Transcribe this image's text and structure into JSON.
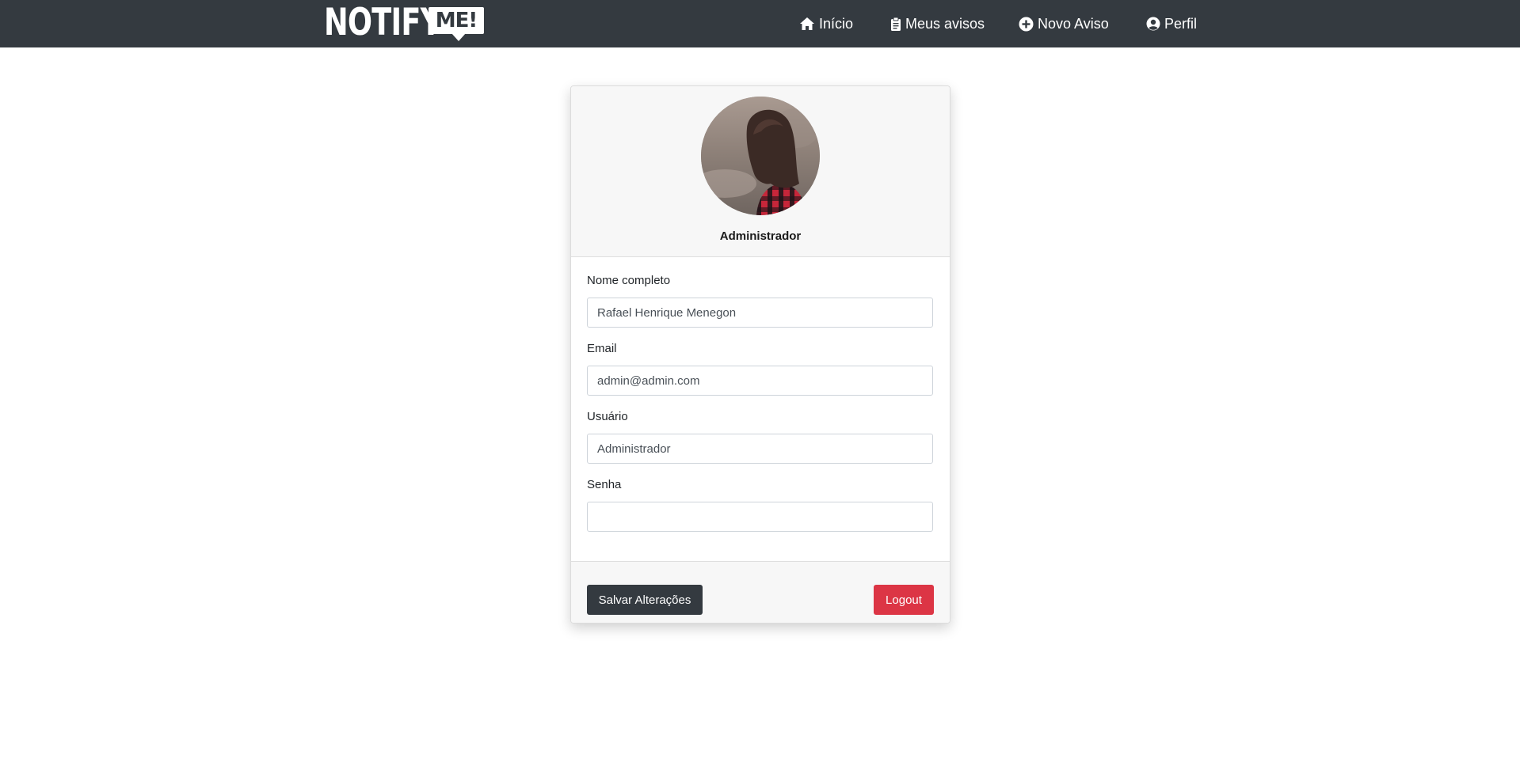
{
  "navbar": {
    "brand": {
      "word": "NOTIFY",
      "badge": "ME!"
    },
    "links": [
      {
        "label": "Início",
        "icon": "home-icon"
      },
      {
        "label": "Meus avisos",
        "icon": "clipboard-icon"
      },
      {
        "label": "Novo Aviso",
        "icon": "plus-circle-icon"
      },
      {
        "label": "Perfil",
        "icon": "user-circle-icon"
      }
    ],
    "colors": {
      "background": "#343a40",
      "text": "#ffffff"
    }
  },
  "profile": {
    "display_name": "Administrador",
    "avatar": "avatar-photo"
  },
  "form": {
    "fields": [
      {
        "label": "Nome completo",
        "value": "Rafael Henrique Menegon",
        "placeholder": ""
      },
      {
        "label": "Email",
        "value": "admin@admin.com",
        "placeholder": ""
      },
      {
        "label": "Usuário",
        "value": "Administrador",
        "placeholder": ""
      },
      {
        "label": "Senha",
        "value": "",
        "placeholder": ""
      }
    ]
  },
  "actions": {
    "save_label": "Salvar Alterações",
    "logout_label": "Logout",
    "colors": {
      "save": "#343a40",
      "logout": "#dc3545"
    }
  }
}
